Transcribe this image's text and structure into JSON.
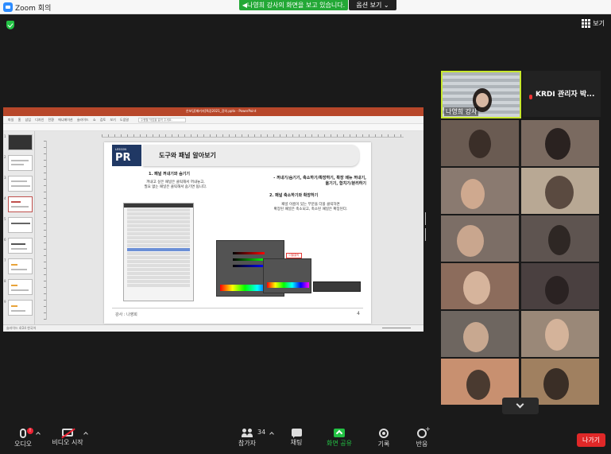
{
  "window": {
    "title": "Zoom 회의"
  },
  "share_banner": {
    "text": "◀나영희 강사의 화면을 보고 있습니다.",
    "options_label": "옵션 보기 ⌄"
  },
  "view": {
    "label": "보기"
  },
  "ppt": {
    "title": "온보딩[패키지]특강2021_강의.pptx - PowerPoint",
    "tabs": "파일 홈 삽입 디자인 전환 애니메이션 슬라이드 쇼 검토 보기 도움말",
    "search_placeholder": "수행할 작업을 알려 주세요.",
    "status": "슬라이드 4/24  한국어",
    "thumb_numbers": [
      "1",
      "2",
      "3",
      "4",
      "5",
      "6",
      "7",
      "8",
      "9"
    ]
  },
  "slide": {
    "lesson_small": "LESSON",
    "lesson_big": "PR",
    "title": "도구와 패널 알아보기",
    "section1": "1. 패널 꺼내기와 숨기기",
    "desc1": "꺼내고 싶은 패널은 클릭해서 꺼내놓고,\n필요 없는 패널은 클릭해서 숨기면 됩니다.",
    "bullets": "- 꺼내기/숨기기, 축소하기/확장하기, 확장 메뉴 꺼내기,\n옮기기, 합치기/분리하기",
    "section2": "2. 패널 축소하기와 확장하기",
    "desc2": "패널 이름이 있는 부분을 더블 클릭하면\n확장된 패널은 축소되고, 축소된 패널은 확장된다.",
    "red_label": "더블클릭",
    "presenter": "강사 : 나영희",
    "page": "4"
  },
  "gallery": {
    "speaker": {
      "name": "나영희 강사"
    },
    "admin": {
      "name": "KRDI 관리자 박..."
    }
  },
  "toolbar": {
    "audio": "오디오",
    "audio_badge": "!",
    "video": "비디오 시작",
    "participants": "참가자",
    "participants_count": "34",
    "chat": "채팅",
    "share": "화면 공유",
    "record": "기록",
    "reactions": "반응",
    "leave": "나가기"
  },
  "colors": {
    "share_green": "#23a836",
    "speaker_border": "#c8e82e",
    "leave_red": "#e02828",
    "ppt_red": "#b7472a",
    "lesson_navy": "#203864"
  }
}
